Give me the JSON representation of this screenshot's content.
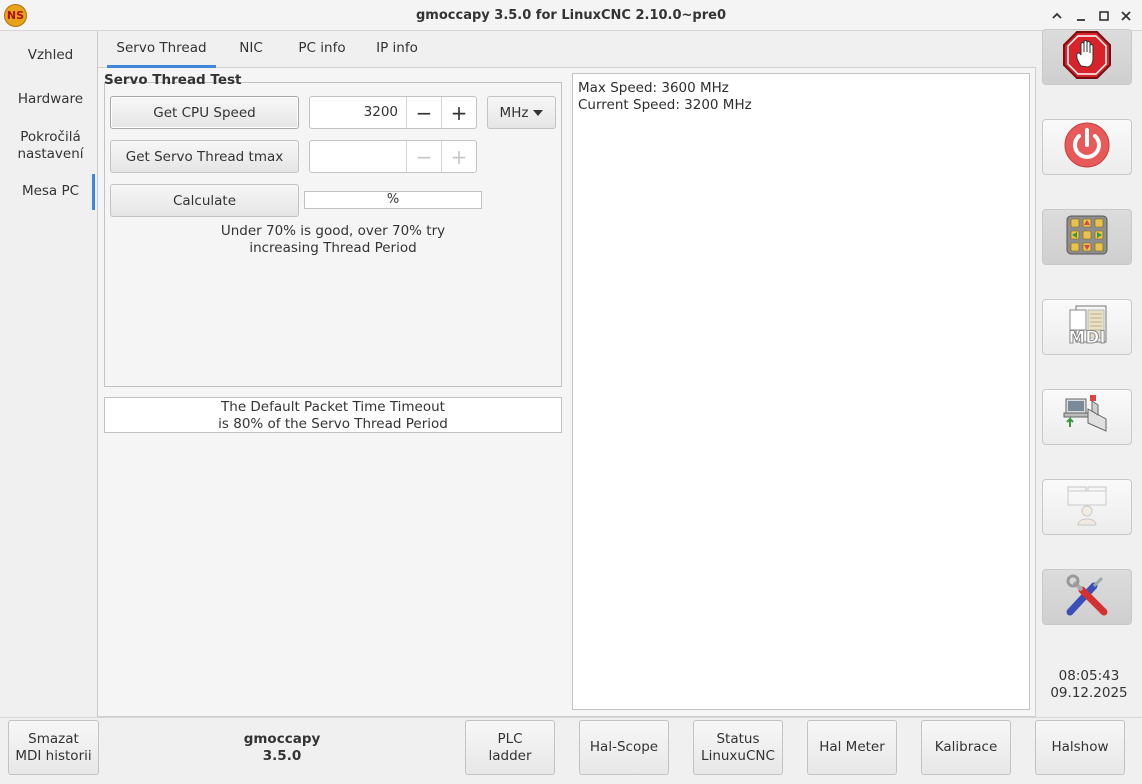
{
  "window": {
    "title": "gmoccapy  3.5.0 for LinuxCNC 2.10.0~pre0",
    "logo_text": "NS"
  },
  "sidebar": {
    "items": [
      {
        "label": "Vzhled"
      },
      {
        "label": "Hardware"
      },
      {
        "label": "Pokročilá nastavení",
        "line1": "Pokročilá",
        "line2": "nastavení"
      },
      {
        "label": "Mesa PC"
      }
    ],
    "active": "Mesa PC"
  },
  "tabs": [
    {
      "label": "Servo Thread"
    },
    {
      "label": "NIC"
    },
    {
      "label": "PC info"
    },
    {
      "label": "IP info"
    }
  ],
  "servo_test": {
    "frame_title": "Servo Thread Test",
    "get_cpu_speed_label": "Get CPU Speed",
    "cpu_speed_value": "3200",
    "unit_selected": "MHz",
    "get_tmax_label": "Get Servo Thread tmax",
    "tmax_value": "",
    "calculate_label": "Calculate",
    "percent_text": "%",
    "percent_value": null,
    "note_line1": "Under 70% is good, over 70% try",
    "note_line2": "increasing Thread Period"
  },
  "timeout_note": {
    "line1": "The Default Packet Time Timeout",
    "line2": "is 80% of the Servo Thread Period"
  },
  "output_text": {
    "line1": "Max Speed: 3600 MHz",
    "line2": "Current Speed: 3200 MHz"
  },
  "right_toolbar": {
    "mdi_icon_text": "MDI"
  },
  "clock": {
    "time": "08:05:43",
    "date": "09.12.2025"
  },
  "bottom": {
    "clear_mdi": {
      "line1": "Smazat",
      "line2": "MDI historii"
    },
    "app_name": "gmoccapy",
    "app_version": "3.5.0",
    "plc": {
      "line1": "PLC",
      "line2": "ladder"
    },
    "hal_scope": "Hal-Scope",
    "status": {
      "line1": "Status",
      "line2": "LinuxuCNC"
    },
    "hal_meter": "Hal Meter",
    "calibration": "Kalibrace",
    "halshow": "Halshow"
  },
  "colors": {
    "accent": "#3d86d8",
    "estop_red": "#d8232a",
    "power_red": "#e85a5a"
  }
}
